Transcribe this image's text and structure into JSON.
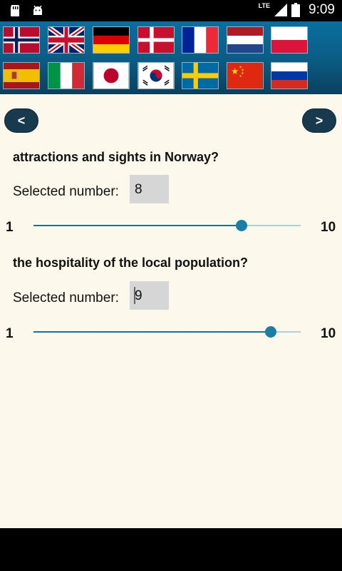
{
  "status_bar": {
    "time": "9:09",
    "network": "LTE",
    "icons": [
      "sd-card-icon",
      "android-icon",
      "signal-icon",
      "battery-icon"
    ]
  },
  "flags": [
    {
      "name": "Norway",
      "icon": "flag-norway-icon"
    },
    {
      "name": "United Kingdom",
      "icon": "flag-uk-icon"
    },
    {
      "name": "Germany",
      "icon": "flag-germany-icon"
    },
    {
      "name": "Denmark",
      "icon": "flag-denmark-icon"
    },
    {
      "name": "France",
      "icon": "flag-france-icon"
    },
    {
      "name": "Netherlands",
      "icon": "flag-netherlands-icon"
    },
    {
      "name": "Poland",
      "icon": "flag-poland-icon"
    },
    {
      "name": "Spain",
      "icon": "flag-spain-icon"
    },
    {
      "name": "Italy",
      "icon": "flag-italy-icon"
    },
    {
      "name": "Japan",
      "icon": "flag-japan-icon"
    },
    {
      "name": "South Korea",
      "icon": "flag-korea-icon"
    },
    {
      "name": "Sweden",
      "icon": "flag-sweden-icon"
    },
    {
      "name": "China",
      "icon": "flag-china-icon"
    },
    {
      "name": "Russia",
      "icon": "flag-russia-icon"
    }
  ],
  "nav": {
    "prev_label": "<",
    "next_label": ">"
  },
  "questions": [
    {
      "text": "attractions and sights in Norway?",
      "selected_label": "Selected number:",
      "selected_value": "8",
      "slider_min": "1",
      "slider_max": "10",
      "slider_value": 8
    },
    {
      "text": "the hospitality of the local population?",
      "selected_label": "Selected number:",
      "selected_value": "9",
      "slider_min": "1",
      "slider_max": "10",
      "slider_value": 9
    }
  ],
  "colors": {
    "header_gradient_top": "#0a6f9e",
    "header_gradient_bottom": "#0a3f5e",
    "background": "#fdf8ec",
    "button": "#173a4f",
    "slider_fill": "#1e6f9a",
    "slider_track": "#a7d3e0",
    "slider_thumb": "#1b7ea8",
    "selected_box": "#d6d6d6"
  }
}
